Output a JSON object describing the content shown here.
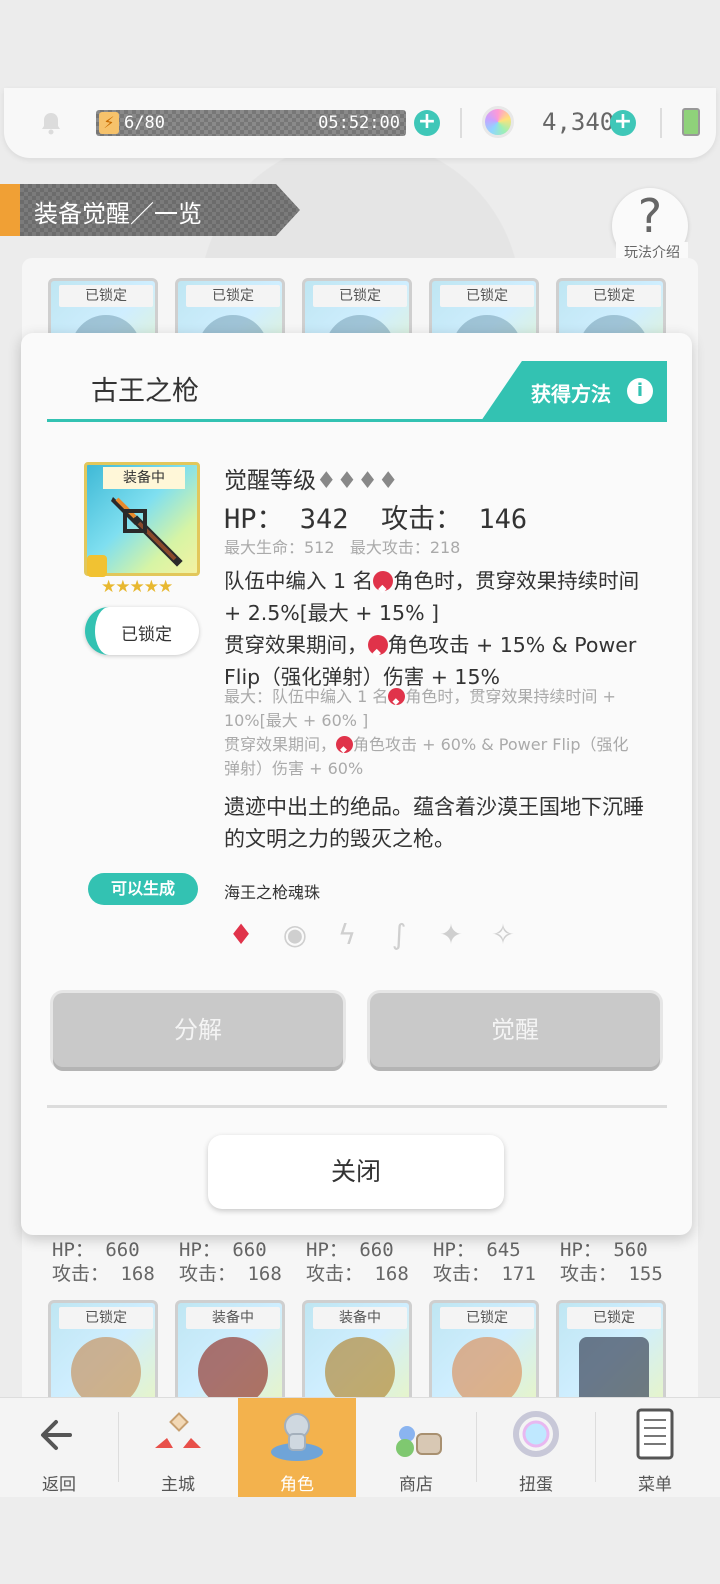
{
  "status_bar": {
    "stamina": "6/80",
    "timer": "05:52:00",
    "gems": "4,340"
  },
  "section": {
    "title": "装备觉醒／一览",
    "help_label": "玩法介绍"
  },
  "grid": {
    "top_tags": [
      "已锁定",
      "已锁定",
      "已锁定",
      "已锁定",
      "已锁定"
    ],
    "stats_hp": [
      "HP： 660",
      "HP： 660",
      "HP： 660",
      "HP： 645",
      "HP： 560"
    ],
    "stats_atk": [
      "攻击： 168",
      "攻击： 168",
      "攻击： 168",
      "攻击： 171",
      "攻击： 155"
    ],
    "bottom_tags": [
      "已锁定",
      "装备中",
      "装备中",
      "已锁定",
      "已锁定"
    ]
  },
  "modal": {
    "title": "古王之枪",
    "acquire_label": "获得方法",
    "item_tag": "装备中",
    "lock_label": "已锁定",
    "awaken_label": "觉醒等级",
    "awaken_diamonds": "♦♦♦♦",
    "hp_label": "HP：",
    "hp_value": "342",
    "atk_label": "攻击：",
    "atk_value": "146",
    "max_hp": "最大生命：512",
    "max_atk": "最大攻击：218",
    "desc1_a": "队伍中编入 1 名",
    "desc1_b": "角色时，贯穿效果持续时间 + 2.5%[最大 + 15% ]",
    "desc2_a": "贯穿效果期间，",
    "desc2_b": "角色攻击 + 15% & Power Flip（强化弹射）伤害 + 15%",
    "max1_a": "最大：队伍中编入 1 名",
    "max1_b": "角色时，贯穿效果持续时间 + 10%[最大 + 60% ]",
    "max2_a": "贯穿效果期间，",
    "max2_b": "角色攻击 + 60% & Power Flip（强化弹射）伤害 + 60%",
    "flavor": "遗迹中出土的绝品。蕴含着沙漠王国地下沉睡的文明之力的毁灭之枪。",
    "gen_badge": "可以生成",
    "gen_name": "海王之枪魂珠",
    "btn_dismantle": "分解",
    "btn_awaken": "觉醒",
    "btn_close": "关闭"
  },
  "nav": {
    "back": "返回",
    "main": "主城",
    "character": "角色",
    "shop": "商店",
    "gacha": "扭蛋",
    "menu": "菜单"
  },
  "colors": {
    "accent": "#33c2b2",
    "nav_active": "#f3b24d",
    "element_red": "#e0334a"
  }
}
